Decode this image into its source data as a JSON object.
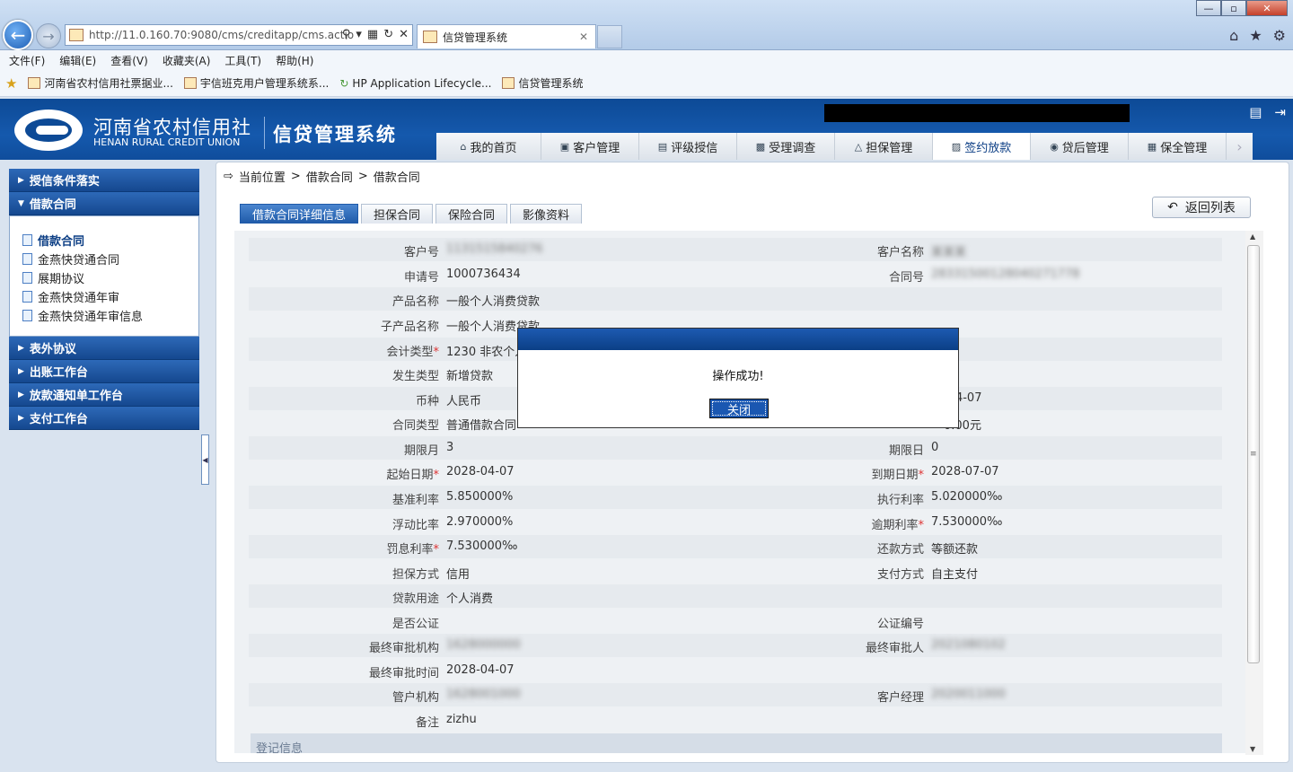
{
  "browser": {
    "url": "http://11.0.160.70:9080/cms/creditapp/cms.actio",
    "tab_title": "信贷管理系统",
    "window_buttons": {
      "min": "—",
      "max": "▫",
      "close": "✕"
    },
    "menu": [
      "文件(F)",
      "编辑(E)",
      "查看(V)",
      "收藏夹(A)",
      "工具(T)",
      "帮助(H)"
    ],
    "favorites": [
      "河南省农村信用社票据业...",
      "宇信班克用户管理系统系...",
      "HP Application Lifecycle...",
      "信贷管理系统"
    ]
  },
  "header": {
    "logo_cn": "河南省农村信用社",
    "logo_en": "HENAN RURAL CREDIT UNION",
    "system_name": "信贷管理系统",
    "nav": [
      {
        "label": "我的首页",
        "icon": "home-icon"
      },
      {
        "label": "客户管理",
        "icon": "customer-icon"
      },
      {
        "label": "评级授信",
        "icon": "rating-icon"
      },
      {
        "label": "受理调查",
        "icon": "survey-icon"
      },
      {
        "label": "担保管理",
        "icon": "guarantee-icon"
      },
      {
        "label": "签约放款",
        "icon": "contract-icon",
        "active": true
      },
      {
        "label": "贷后管理",
        "icon": "postloan-icon"
      },
      {
        "label": "保全管理",
        "icon": "preservation-icon"
      }
    ]
  },
  "sidebar": {
    "sections": [
      {
        "label": "授信条件落实"
      },
      {
        "label": "借款合同",
        "expanded": true,
        "items": [
          "借款合同",
          "金燕快贷通合同",
          "展期协议",
          "金燕快贷通年审",
          "金燕快贷通年审信息"
        ]
      },
      {
        "label": "表外协议"
      },
      {
        "label": "出账工作台"
      },
      {
        "label": "放款通知单工作台"
      },
      {
        "label": "支付工作台"
      }
    ]
  },
  "breadcrumb": {
    "root": "当前位置",
    "sep": ">",
    "level1": "借款合同",
    "level2": "借款合同"
  },
  "subtabs": [
    "借款合同详细信息",
    "担保合同",
    "保险合同",
    "影像资料"
  ],
  "return_label": "返回列表",
  "form": {
    "customer_no": {
      "label": "客户号",
      "value": "1131515840276"
    },
    "customer_name": {
      "label": "客户名称",
      "value": "某某某"
    },
    "apply_no": {
      "label": "申请号",
      "value": "1000736434"
    },
    "contract_no": {
      "label": "合同号",
      "value": "28331500128040271778"
    },
    "product_name": {
      "label": "产品名称",
      "value": "一般个人消费贷款"
    },
    "sub_product_name": {
      "label": "子产品名称",
      "value": "一般个人消费贷款"
    },
    "account_type": {
      "label": "会计类型",
      "value": "1230 非农个人"
    },
    "occur_type": {
      "label": "发生类型",
      "value": "新增贷款"
    },
    "currency": {
      "label": "币种",
      "value": "人民币"
    },
    "right_row9": {
      "value": "-04-07"
    },
    "contract_type": {
      "label": "合同类型",
      "value": "普通借款合同"
    },
    "right_row10": {
      "value": "0.00元"
    },
    "term_month": {
      "label": "期限月",
      "value": "3"
    },
    "term_day": {
      "label": "期限日",
      "value": "0"
    },
    "start_date": {
      "label": "起始日期",
      "value": "2028-04-07"
    },
    "end_date": {
      "label": "到期日期",
      "value": "2028-07-07"
    },
    "base_rate": {
      "label": "基准利率",
      "value": "5.850000%"
    },
    "exec_rate": {
      "label": "执行利率",
      "value": "5.020000‰"
    },
    "float_ratio": {
      "label": "浮动比率",
      "value": "2.970000%"
    },
    "overdue_rate": {
      "label": "逾期利率",
      "value": "7.530000‰"
    },
    "penalty_rate": {
      "label": "罚息利率",
      "value": "7.530000‰"
    },
    "repay_mode": {
      "label": "还款方式",
      "value": "等额还款"
    },
    "guarantee_mode": {
      "label": "担保方式",
      "value": "信用"
    },
    "pay_mode": {
      "label": "支付方式",
      "value": "自主支付"
    },
    "loan_usage": {
      "label": "贷款用途",
      "value": "个人消费"
    },
    "notarized": {
      "label": "是否公证",
      "value": ""
    },
    "notary_no": {
      "label": "公证编号",
      "value": ""
    },
    "final_org": {
      "label": "最终审批机构",
      "value": "1628000000"
    },
    "final_approver": {
      "label": "最终审批人",
      "value": "2021080102"
    },
    "final_time": {
      "label": "最终审批时间",
      "value": "2028-04-07"
    },
    "mgr_org": {
      "label": "管户机构",
      "value": "1628001000"
    },
    "cust_mgr": {
      "label": "客户经理",
      "value": "2020011000"
    },
    "remark": {
      "label": "备注",
      "value": "zizhu"
    }
  },
  "section_reg": "登记信息",
  "dialog": {
    "message": "操作成功!",
    "close_label": "关闭"
  }
}
